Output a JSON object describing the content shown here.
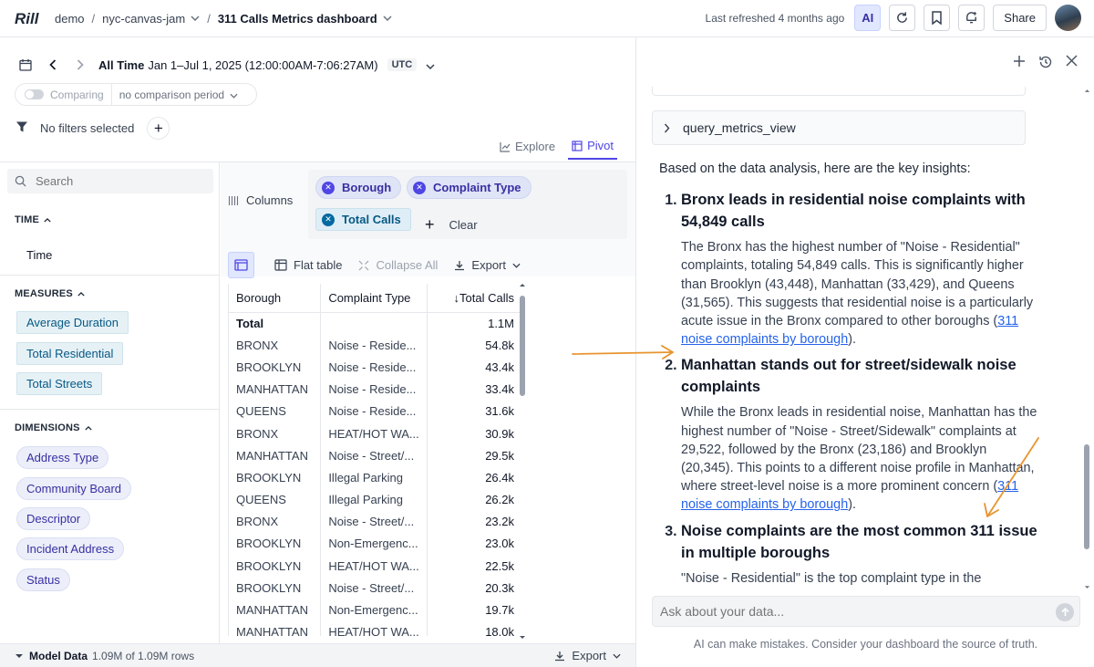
{
  "header": {
    "breadcrumb": [
      "demo",
      "nyc-canvas-jam",
      "311 Calls Metrics dashboard"
    ],
    "last_refreshed": "Last refreshed 4 months ago",
    "ai_label": "AI",
    "share_label": "Share"
  },
  "time_controls": {
    "range_label": "All Time",
    "range_value": "Jan 1–Jul 1, 2025 (12:00:00AM-7:06:27AM)",
    "timezone": "UTC",
    "comparing_label": "Comparing",
    "comparison_period": "no comparison period"
  },
  "filters": {
    "text": "No filters selected"
  },
  "view_tabs": [
    {
      "label": "Explore",
      "icon": "chart-line-icon",
      "active": false
    },
    {
      "label": "Pivot",
      "icon": "pivot-icon",
      "active": true
    }
  ],
  "sidebar": {
    "search_placeholder": "Search",
    "time_header": "TIME",
    "time_items": [
      "Time"
    ],
    "measures_header": "MEASURES",
    "measures": [
      "Average Duration",
      "Total Residential",
      "Total Streets"
    ],
    "dimensions_header": "DIMENSIONS",
    "dimensions": [
      "Address Type",
      "Community Board",
      "Descriptor",
      "Incident Address",
      "Status"
    ]
  },
  "pivot": {
    "columns_label": "Columns",
    "column_chips": [
      {
        "label": "Borough",
        "kind": "dimension"
      },
      {
        "label": "Complaint Type",
        "kind": "dimension"
      },
      {
        "label": "Total Calls",
        "kind": "measure"
      }
    ],
    "clear_label": "Clear",
    "toolbar": {
      "flat_table": "Flat table",
      "collapse_all": "Collapse All",
      "export": "Export"
    },
    "table": {
      "headers": [
        "Borough",
        "Complaint Type",
        "↓Total Calls"
      ],
      "rows": [
        [
          "Total",
          "",
          "1.1M"
        ],
        [
          "BRONX",
          "Noise - Reside...",
          "54.8k"
        ],
        [
          "BROOKLYN",
          "Noise - Reside...",
          "43.4k"
        ],
        [
          "MANHATTAN",
          "Noise - Reside...",
          "33.4k"
        ],
        [
          "QUEENS",
          "Noise - Reside...",
          "31.6k"
        ],
        [
          "BRONX",
          "HEAT/HOT WA...",
          "30.9k"
        ],
        [
          "MANHATTAN",
          "Noise - Street/...",
          "29.5k"
        ],
        [
          "BROOKLYN",
          "Illegal Parking",
          "26.4k"
        ],
        [
          "QUEENS",
          "Illegal Parking",
          "26.2k"
        ],
        [
          "BRONX",
          "Noise - Street/...",
          "23.2k"
        ],
        [
          "BROOKLYN",
          "Non-Emergenc...",
          "23.0k"
        ],
        [
          "BROOKLYN",
          "HEAT/HOT WA...",
          "22.5k"
        ],
        [
          "BROOKLYN",
          "Noise - Street/...",
          "20.3k"
        ],
        [
          "MANHATTAN",
          "Non-Emergenc...",
          "19.7k"
        ],
        [
          "MANHATTAN",
          "HEAT/HOT WA...",
          "18.0k"
        ]
      ]
    }
  },
  "bottom_bar": {
    "model_data_label": "Model Data",
    "rows_text": "1.09M of 1.09M rows",
    "export_label": "Export"
  },
  "chat": {
    "tool_call_label": "query_metrics_view",
    "intro": "Based on the data analysis, here are the key insights:",
    "insights": [
      {
        "title": "Bronx leads in residential noise complaints with 54,849 calls",
        "body": "The Bronx has the highest number of \"Noise - Residential\" complaints, totaling 54,849 calls. This is significantly higher than Brooklyn (43,448), Manhattan (33,429), and Queens (31,565). This suggests that residential noise is a particularly acute issue in the Bronx compared to other boroughs (",
        "link": "311 noise complaints by borough",
        "tail": ")."
      },
      {
        "title": "Manhattan stands out for street/sidewalk noise complaints",
        "body": "While the Bronx leads in residential noise, Manhattan has the highest number of \"Noise - Street/Sidewalk\" complaints at 29,522, followed by the Bronx (23,186) and Brooklyn (20,345). This points to a different noise profile in Manhattan, where street-level noise is a more prominent concern (",
        "link": "311 noise complaints by borough",
        "tail": ")."
      },
      {
        "title": "Noise complaints are the most common 311 issue in multiple boroughs",
        "body": "\"Noise - Residential\" is the top complaint type in the",
        "link": "",
        "tail": ""
      }
    ],
    "input_placeholder": "Ask about your data...",
    "disclaimer": "AI can make mistakes. Consider your dashboard the source of truth.",
    "annotation_color": "#e8942e"
  }
}
